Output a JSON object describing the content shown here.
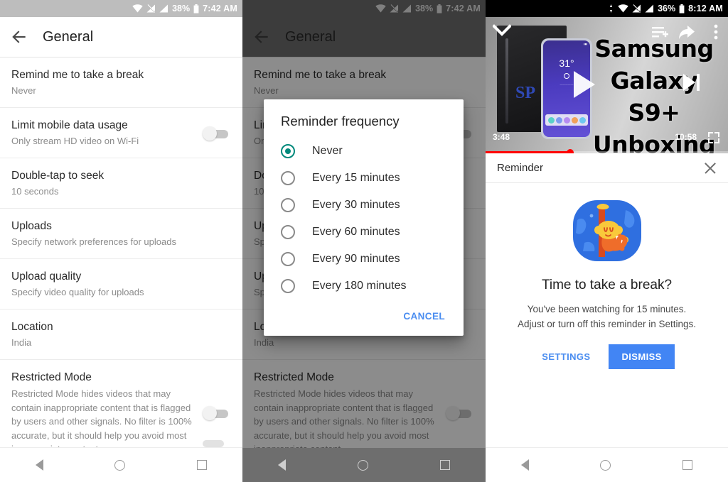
{
  "panels": [
    {
      "status": {
        "wifi": "wifi-icon",
        "signal_off": "signal-no-sim-icon",
        "signal": "signal-icon",
        "battery_pct": "38%",
        "battery": "battery-icon",
        "time": "7:42 AM"
      },
      "appbar": {
        "back": "back-arrow-icon",
        "title": "General"
      }
    },
    {
      "status": {
        "battery_pct": "38%",
        "time": "7:42 AM"
      },
      "appbar": {
        "title": "General"
      }
    },
    {
      "status": {
        "cast": "cast-icon",
        "battery_pct": "36%",
        "time": "8:12 AM"
      }
    }
  ],
  "settings_list": [
    {
      "title": "Remind me to take a break",
      "sub": "Never",
      "toggle": false
    },
    {
      "title": "Limit mobile data usage",
      "sub": "Only stream HD video on Wi-Fi",
      "toggle": true
    },
    {
      "title": "Double-tap to seek",
      "sub": "10 seconds",
      "toggle": false
    },
    {
      "title": "Uploads",
      "sub": "Specify network preferences for uploads",
      "toggle": false
    },
    {
      "title": "Upload quality",
      "sub": "Specify video quality for uploads",
      "toggle": false
    },
    {
      "title": "Location",
      "sub": "India",
      "toggle": false
    },
    {
      "title": "Restricted Mode",
      "sub": "Restricted Mode hides videos that may contain inappropriate content that is flagged by users and other signals. No filter is 100% accurate, but it should help you avoid most inappropriate content.",
      "toggle": true
    }
  ],
  "dialog": {
    "title": "Reminder frequency",
    "options": [
      {
        "label": "Never",
        "selected": true
      },
      {
        "label": "Every 15 minutes",
        "selected": false
      },
      {
        "label": "Every 30 minutes",
        "selected": false
      },
      {
        "label": "Every 60 minutes",
        "selected": false
      },
      {
        "label": "Every 90 minutes",
        "selected": false
      },
      {
        "label": "Every 180 minutes",
        "selected": false
      }
    ],
    "cancel_label": "CANCEL",
    "accent": "#00897b",
    "action_color": "#4a8df0"
  },
  "player": {
    "title_line1": "Samsung",
    "title_line2": "Galaxy S9+",
    "title_line3": "Unboxing",
    "elapsed": "3:48",
    "duration": "10:58",
    "progress_pct": 35,
    "progress_color": "#ff0000",
    "thumb_temp": "31°",
    "thumb_brand": "SP",
    "controls": {
      "collapse": "chevron-down-icon",
      "queue": "add-to-queue-icon",
      "share": "share-icon",
      "more": "more-vertical-icon",
      "play": "play-icon",
      "next": "next-icon",
      "fullscreen": "fullscreen-icon"
    }
  },
  "reminder_card": {
    "header_title": "Reminder",
    "close": "close-icon",
    "illustration": "monkey-drinking-illustration",
    "heading": "Time to take a break?",
    "body_line1": "You've been watching for 15 minutes.",
    "body_line2": "Adjust or turn off this reminder in Settings.",
    "settings_label": "SETTINGS",
    "dismiss_label": "DISMISS",
    "dismiss_bg": "#4285f4"
  },
  "navbar": {
    "back": "nav-back-icon",
    "home": "nav-home-icon",
    "recents": "nav-recents-icon"
  }
}
